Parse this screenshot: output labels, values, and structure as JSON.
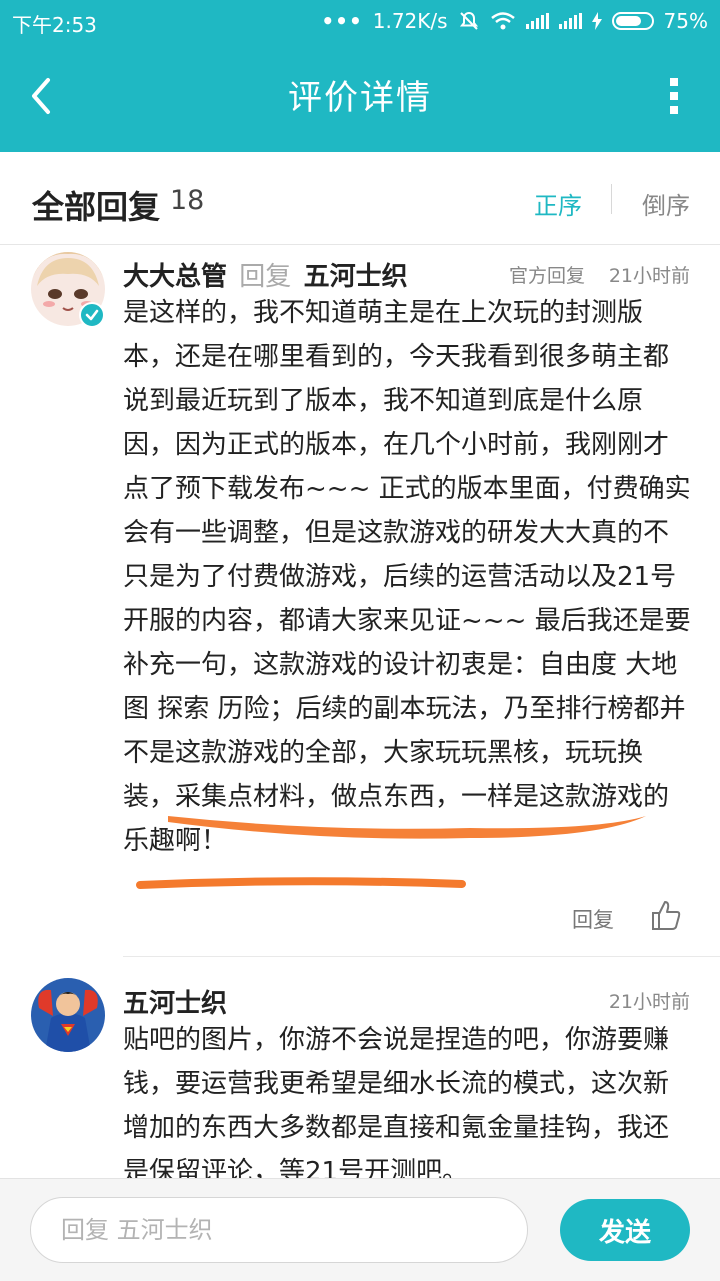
{
  "status_bar": {
    "time": "下午2:53",
    "dots": "•••",
    "speed": "1.72K/s",
    "battery": "75%"
  },
  "header": {
    "title": "评价详情",
    "back_icon": "back-chevron-icon",
    "more_icon": "more-vertical-icon"
  },
  "replies": {
    "title": "全部回复",
    "count": "18",
    "sort_asc": "正序",
    "sort_desc": "倒序"
  },
  "comments": [
    {
      "author": "大大总管",
      "reply_word": "回复",
      "reply_to": "五河士织",
      "official_tag": "官方回复",
      "time": "21小时前",
      "text": "是这样的，我不知道萌主是在上次玩的封测版本，还是在哪里看到的，今天我看到很多萌主都说到最近玩到了版本，我不知道到底是什么原因，因为正式的版本，在几个小时前，我刚刚才点了预下载发布~~~ 正式的版本里面，付费确实会有一些调整，但是这款游戏的研发大大真的不只是为了付费做游戏，后续的运营活动以及21号开服的内容，都请大家来见证~~~ 最后我还是要补充一句，这款游戏的设计初衷是：自由度 大地图 探索 历险；后续的副本玩法，乃至排行榜都并不是这款游戏的全部，大家玩玩黑核，玩玩换装，采集点材料，做点东西，一样是这款游戏的乐趣啊！",
      "reply_action": "回复",
      "verified": true
    },
    {
      "author": "五河士织",
      "time": "21小时前",
      "text": "贴吧的图片，你游不会说是捏造的吧，你游要赚钱，要运营我更希望是细水长流的模式，这次新增加的东西大多数都是直接和氪金量挂钩，我还是保留评论，等21号开测吧。"
    }
  ],
  "composer": {
    "placeholder": "回复 五河士织",
    "send_label": "发送"
  },
  "colors": {
    "accent": "#1fb8c3",
    "underline": "#f47a2d"
  }
}
